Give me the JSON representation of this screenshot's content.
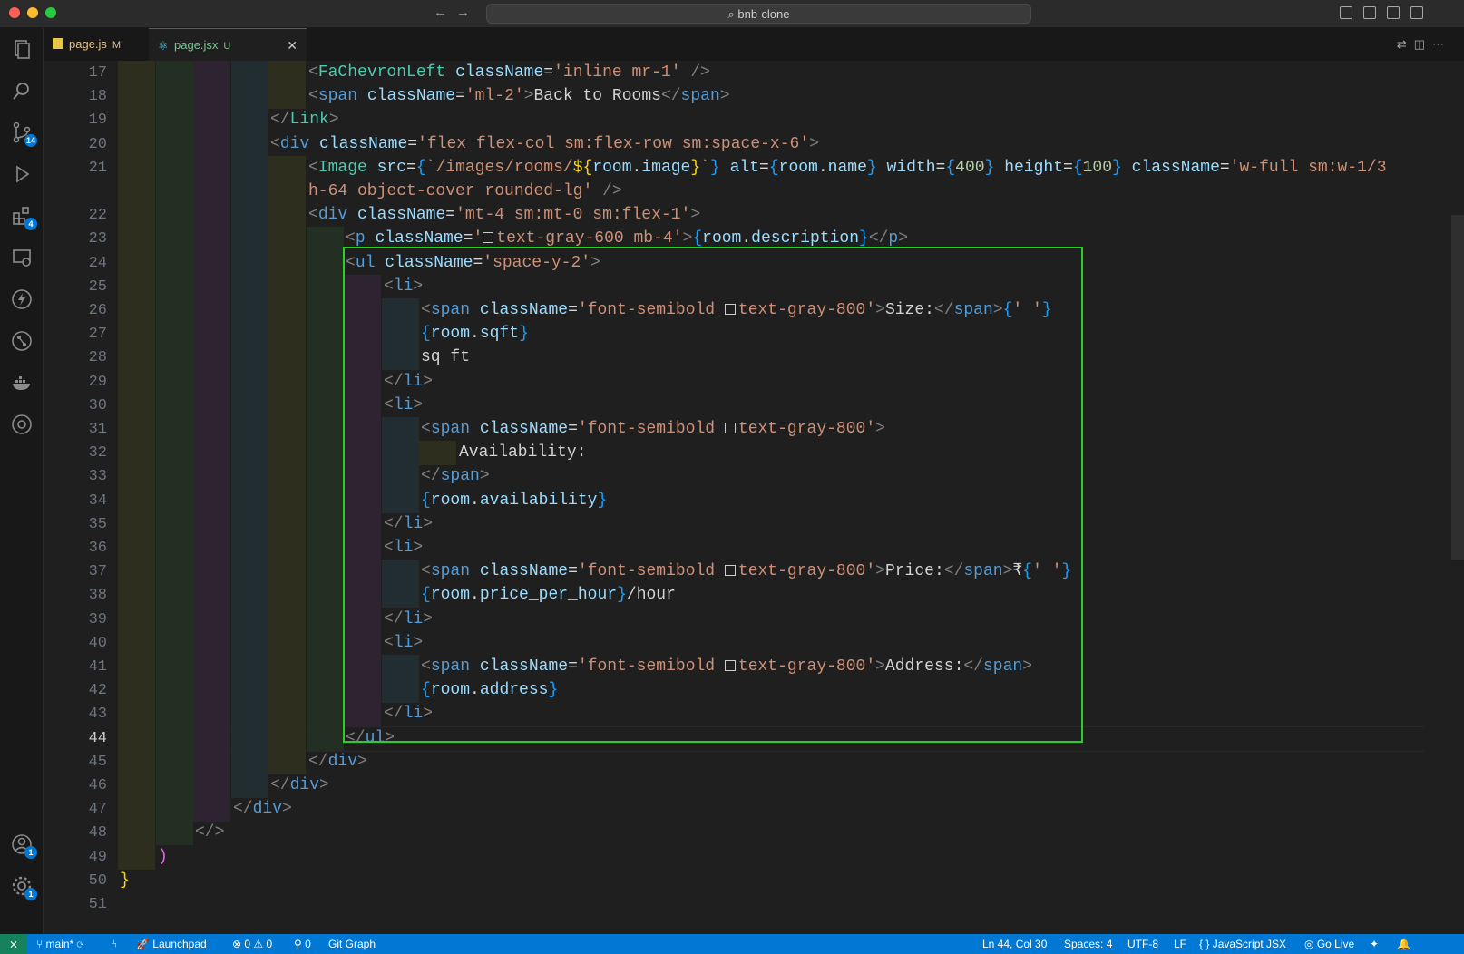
{
  "window": {
    "search_title": "bnb-clone"
  },
  "activity_bar": {
    "items": [
      {
        "icon": "files-icon",
        "badge": null
      },
      {
        "icon": "search-icon",
        "badge": null
      },
      {
        "icon": "source-control-icon",
        "badge": "14"
      },
      {
        "icon": "run-debug-icon",
        "badge": null
      },
      {
        "icon": "extensions-icon",
        "badge": "4"
      },
      {
        "icon": "remote-explorer-icon",
        "badge": null
      },
      {
        "icon": "thunder-client-icon",
        "badge": null
      },
      {
        "icon": "git-graph-icon",
        "badge": null
      },
      {
        "icon": "docker-icon",
        "badge": null
      },
      {
        "icon": "gitlens-icon",
        "badge": null
      }
    ],
    "bottom": [
      {
        "icon": "accounts-icon",
        "badge": "1"
      },
      {
        "icon": "settings-gear-icon",
        "badge": "1"
      }
    ]
  },
  "tabs": [
    {
      "label": "page.js",
      "status": "M",
      "active": false
    },
    {
      "label": "page.jsx",
      "status": "U",
      "active": true
    }
  ],
  "editor": {
    "current_line": 44,
    "lines": [
      {
        "num": "17",
        "indent": 5,
        "html": "<span class='t'>&lt;</span><span class='cp'>FaChevronLeft</span> <span class='at'>className</span><span class='tx'>=</span><span class='st'>'inline mr-1'</span> <span class='t'>/&gt;</span>"
      },
      {
        "num": "18",
        "indent": 5,
        "html": "<span class='t'>&lt;</span><span class='tg'>span</span> <span class='at'>className</span><span class='tx'>=</span><span class='st'>'ml-2'</span><span class='t'>&gt;</span><span class='tx'>Back to Rooms</span><span class='t'>&lt;/</span><span class='tg'>span</span><span class='t'>&gt;</span>"
      },
      {
        "num": "19",
        "indent": 4,
        "html": "<span class='t'>&lt;/</span><span class='cp'>Link</span><span class='t'>&gt;</span>"
      },
      {
        "num": "20",
        "indent": 4,
        "html": "<span class='t'>&lt;</span><span class='tg'>div</span> <span class='at'>className</span><span class='tx'>=</span><span class='st'>'flex flex-col sm:flex-row sm:space-x-6'</span><span class='t'>&gt;</span>"
      },
      {
        "num": "21",
        "indent": 5,
        "html": "<span class='t'>&lt;</span><span class='cp'>Image</span> <span class='at'>src</span><span class='tx'>=</span><span class='br'>{</span><span class='st'>`/images/rooms/</span><span class='yl'>${</span><span class='vr'>room</span><span class='tx'>.</span><span class='vr'>image</span><span class='yl'>}</span><span class='st'>`</span><span class='br'>}</span> <span class='at'>alt</span><span class='tx'>=</span><span class='br'>{</span><span class='vr'>room</span><span class='tx'>.</span><span class='vr'>name</span><span class='br'>}</span> <span class='at'>width</span><span class='tx'>=</span><span class='br'>{</span><span class='nm'>400</span><span class='br'>}</span> <span class='at'>height</span><span class='tx'>=</span><span class='br'>{</span><span class='nm'>100</span><span class='br'>}</span> <span class='at'>className</span><span class='tx'>=</span><span class='st'>'w-full sm:w-1/3</span>"
      },
      {
        "num": "",
        "indent": 5,
        "html": "<span class='st'>h-64 object-cover rounded-lg'</span> <span class='t'>/&gt;</span>"
      },
      {
        "num": "22",
        "indent": 5,
        "html": "<span class='t'>&lt;</span><span class='tg'>div</span> <span class='at'>className</span><span class='tx'>=</span><span class='st'>'mt-4 sm:mt-0 sm:flex-1'</span><span class='t'>&gt;</span>"
      },
      {
        "num": "23",
        "indent": 6,
        "html": "<span class='t'>&lt;</span><span class='tg'>p</span> <span class='at'>className</span><span class='tx'>=</span><span class='st'>'</span><span class='sw'></span><span class='st'>text-gray-600 mb-4'</span><span class='t'>&gt;</span><span class='br'>{</span><span class='vr'>room</span><span class='tx'>.</span><span class='vr'>description</span><span class='br'>}</span><span class='t'>&lt;/</span><span class='tg'>p</span><span class='t'>&gt;</span>"
      },
      {
        "num": "24",
        "indent": 6,
        "html": "<span class='t'>&lt;</span><span class='tg'>ul</span> <span class='at'>className</span><span class='tx'>=</span><span class='st'>'space-y-2'</span><span class='t'>&gt;</span>"
      },
      {
        "num": "25",
        "indent": 7,
        "html": "<span class='t'>&lt;</span><span class='tg'>li</span><span class='t'>&gt;</span>"
      },
      {
        "num": "26",
        "indent": 8,
        "html": "<span class='t'>&lt;</span><span class='tg'>span</span> <span class='at'>className</span><span class='tx'>=</span><span class='st'>'font-semibold </span><span class='sw'></span><span class='st'>text-gray-800'</span><span class='t'>&gt;</span><span class='tx'>Size:</span><span class='t'>&lt;/</span><span class='tg'>span</span><span class='t'>&gt;</span><span class='br'>{</span><span class='st'>' '</span><span class='br'>}</span>"
      },
      {
        "num": "27",
        "indent": 8,
        "html": "<span class='br'>{</span><span class='vr'>room</span><span class='tx'>.</span><span class='vr'>sqft</span><span class='br'>}</span>"
      },
      {
        "num": "28",
        "indent": 8,
        "html": "<span class='tx'>sq ft</span>"
      },
      {
        "num": "29",
        "indent": 7,
        "html": "<span class='t'>&lt;/</span><span class='tg'>li</span><span class='t'>&gt;</span>"
      },
      {
        "num": "30",
        "indent": 7,
        "html": "<span class='t'>&lt;</span><span class='tg'>li</span><span class='t'>&gt;</span>"
      },
      {
        "num": "31",
        "indent": 8,
        "html": "<span class='t'>&lt;</span><span class='tg'>span</span> <span class='at'>className</span><span class='tx'>=</span><span class='st'>'font-semibold </span><span class='sw'></span><span class='st'>text-gray-800'</span><span class='t'>&gt;</span>"
      },
      {
        "num": "32",
        "indent": 9,
        "html": "<span class='tx'>Availability:</span>"
      },
      {
        "num": "33",
        "indent": 8,
        "html": "<span class='t'>&lt;/</span><span class='tg'>span</span><span class='t'>&gt;</span>"
      },
      {
        "num": "34",
        "indent": 8,
        "html": "<span class='br'>{</span><span class='vr'>room</span><span class='tx'>.</span><span class='vr'>availability</span><span class='br'>}</span>"
      },
      {
        "num": "35",
        "indent": 7,
        "html": "<span class='t'>&lt;/</span><span class='tg'>li</span><span class='t'>&gt;</span>"
      },
      {
        "num": "36",
        "indent": 7,
        "html": "<span class='t'>&lt;</span><span class='tg'>li</span><span class='t'>&gt;</span>"
      },
      {
        "num": "37",
        "indent": 8,
        "html": "<span class='t'>&lt;</span><span class='tg'>span</span> <span class='at'>className</span><span class='tx'>=</span><span class='st'>'font-semibold </span><span class='sw'></span><span class='st'>text-gray-800'</span><span class='t'>&gt;</span><span class='tx'>Price:</span><span class='t'>&lt;/</span><span class='tg'>span</span><span class='t'>&gt;</span><span class='tx'>₹</span><span class='br'>{</span><span class='st'>' '</span><span class='br'>}</span>"
      },
      {
        "num": "38",
        "indent": 8,
        "html": "<span class='br'>{</span><span class='vr'>room</span><span class='tx'>.</span><span class='vr'>price_per_hour</span><span class='br'>}</span><span class='tx'>/hour</span>"
      },
      {
        "num": "39",
        "indent": 7,
        "html": "<span class='t'>&lt;/</span><span class='tg'>li</span><span class='t'>&gt;</span>"
      },
      {
        "num": "40",
        "indent": 7,
        "html": "<span class='t'>&lt;</span><span class='tg'>li</span><span class='t'>&gt;</span>"
      },
      {
        "num": "41",
        "indent": 8,
        "html": "<span class='t'>&lt;</span><span class='tg'>span</span> <span class='at'>className</span><span class='tx'>=</span><span class='st'>'font-semibold </span><span class='sw'></span><span class='st'>text-gray-800'</span><span class='t'>&gt;</span><span class='tx'>Address:</span><span class='t'>&lt;/</span><span class='tg'>span</span><span class='t'>&gt;</span>"
      },
      {
        "num": "42",
        "indent": 8,
        "html": "<span class='br'>{</span><span class='vr'>room</span><span class='tx'>.</span><span class='vr'>address</span><span class='br'>}</span>"
      },
      {
        "num": "43",
        "indent": 7,
        "html": "<span class='t'>&lt;/</span><span class='tg'>li</span><span class='t'>&gt;</span>"
      },
      {
        "num": "44",
        "indent": 6,
        "html": "<span class='t'>&lt;/</span><span class='tg'>ul</span><span class='t'>&gt;</span>"
      },
      {
        "num": "45",
        "indent": 5,
        "html": "<span class='t'>&lt;/</span><span class='tg'>div</span><span class='t'>&gt;</span>"
      },
      {
        "num": "46",
        "indent": 4,
        "html": "<span class='t'>&lt;/</span><span class='tg'>div</span><span class='t'>&gt;</span>"
      },
      {
        "num": "47",
        "indent": 3,
        "html": "<span class='t'>&lt;/</span><span class='tg'>div</span><span class='t'>&gt;</span>"
      },
      {
        "num": "48",
        "indent": 2,
        "html": "<span class='t'>&lt;/&gt;</span>"
      },
      {
        "num": "49",
        "indent": 1,
        "html": "<span class='pk'>)</span>"
      },
      {
        "num": "50",
        "indent": 0,
        "html": "<span class='yl'>}</span>"
      },
      {
        "num": "51",
        "indent": 0,
        "html": ""
      }
    ]
  },
  "statusbar": {
    "branch": "main*",
    "launchpad": "Launchpad",
    "errors": "0",
    "warnings": "0",
    "ports": "0",
    "git_graph": "Git Graph",
    "position": "Ln 44, Col 30",
    "spaces": "Spaces: 4",
    "encoding": "UTF-8",
    "eol": "LF",
    "language": "JavaScript JSX",
    "golive": "Go Live"
  }
}
